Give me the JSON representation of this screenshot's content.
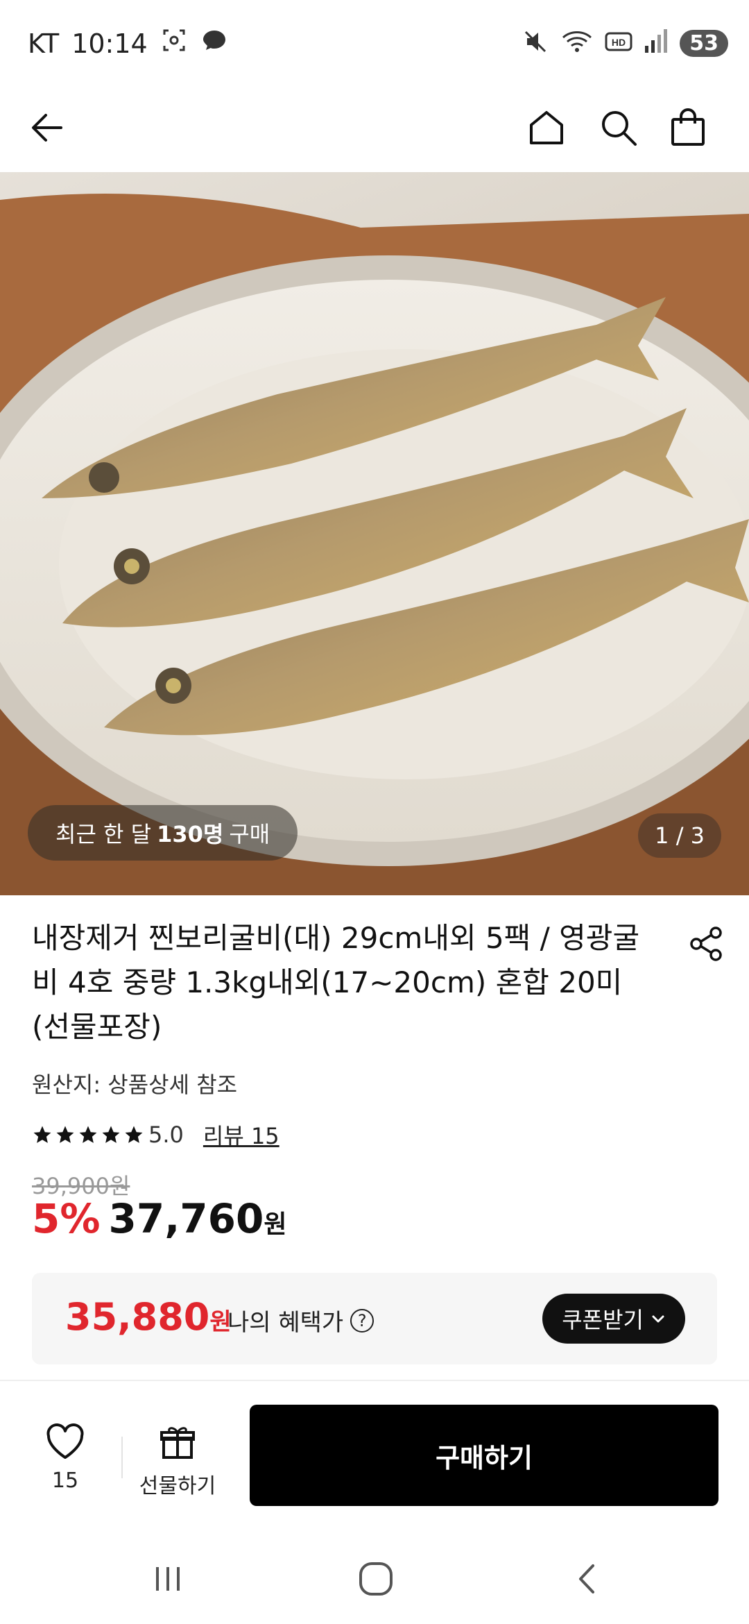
{
  "status_bar": {
    "carrier": "KT",
    "time": "10:14",
    "battery": "53",
    "icons": [
      "screenshot-icon",
      "chat-icon",
      "mute-icon",
      "wifi-icon",
      "hd-icon",
      "signal-icon",
      "battery-icon"
    ]
  },
  "header": {
    "icons": [
      "back-arrow-icon",
      "home-icon",
      "search-icon",
      "shopping-bag-icon"
    ]
  },
  "hero": {
    "badge_prefix": "최근 한 달",
    "badge_count": "130명",
    "badge_suffix": "구매",
    "page_indicator": "1 / 3"
  },
  "product": {
    "title": "내장제거 찐보리굴비(대) 29cm내외 5팩 / 영광굴비 4호 중량 1.3kg내외(17~20cm) 혼합 20미(선물포장)",
    "origin": "원산지: 상품상세 참조",
    "rating": "5.0",
    "rating_stars": 5,
    "review_link": "리뷰 15",
    "original_price": "39,900원",
    "discount": "5%",
    "sale_price": "37,760",
    "currency": "원"
  },
  "benefit": {
    "price": "35,880",
    "currency": "원",
    "label": "나의 혜택가",
    "help": "?",
    "coupon_button": "쿠폰받기"
  },
  "bottom_bar": {
    "wish_count": "15",
    "gift_label": "선물하기",
    "buy_button": "구매하기"
  },
  "nav_bar": {
    "icons": [
      "recent-apps-icon",
      "home-button-icon",
      "back-button-icon"
    ]
  },
  "colors": {
    "accent_red": "#e0262d",
    "button_black": "#000000",
    "card_bg": "#f6f6f6"
  }
}
